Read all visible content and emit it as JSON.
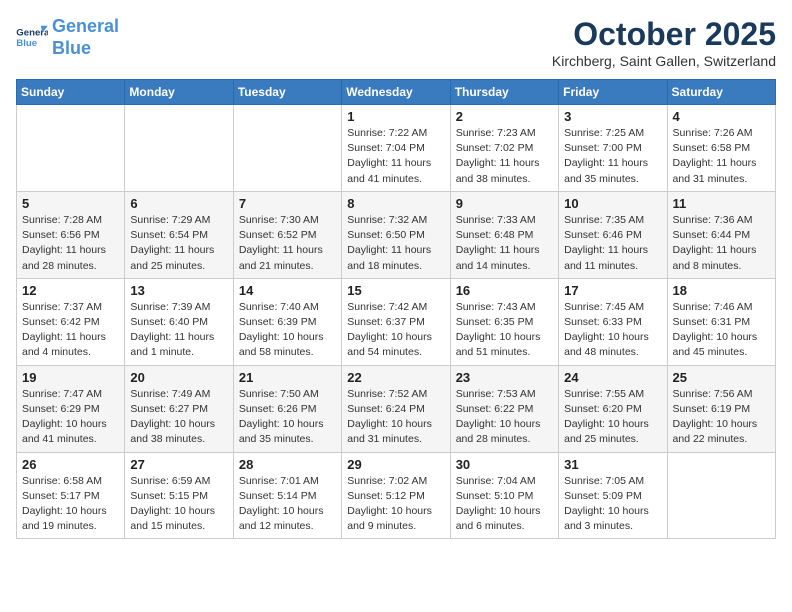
{
  "header": {
    "logo_line1": "General",
    "logo_line2": "Blue",
    "month": "October 2025",
    "location": "Kirchberg, Saint Gallen, Switzerland"
  },
  "days_of_week": [
    "Sunday",
    "Monday",
    "Tuesday",
    "Wednesday",
    "Thursday",
    "Friday",
    "Saturday"
  ],
  "weeks": [
    [
      {
        "day": "",
        "info": ""
      },
      {
        "day": "",
        "info": ""
      },
      {
        "day": "",
        "info": ""
      },
      {
        "day": "1",
        "info": "Sunrise: 7:22 AM\nSunset: 7:04 PM\nDaylight: 11 hours\nand 41 minutes."
      },
      {
        "day": "2",
        "info": "Sunrise: 7:23 AM\nSunset: 7:02 PM\nDaylight: 11 hours\nand 38 minutes."
      },
      {
        "day": "3",
        "info": "Sunrise: 7:25 AM\nSunset: 7:00 PM\nDaylight: 11 hours\nand 35 minutes."
      },
      {
        "day": "4",
        "info": "Sunrise: 7:26 AM\nSunset: 6:58 PM\nDaylight: 11 hours\nand 31 minutes."
      }
    ],
    [
      {
        "day": "5",
        "info": "Sunrise: 7:28 AM\nSunset: 6:56 PM\nDaylight: 11 hours\nand 28 minutes."
      },
      {
        "day": "6",
        "info": "Sunrise: 7:29 AM\nSunset: 6:54 PM\nDaylight: 11 hours\nand 25 minutes."
      },
      {
        "day": "7",
        "info": "Sunrise: 7:30 AM\nSunset: 6:52 PM\nDaylight: 11 hours\nand 21 minutes."
      },
      {
        "day": "8",
        "info": "Sunrise: 7:32 AM\nSunset: 6:50 PM\nDaylight: 11 hours\nand 18 minutes."
      },
      {
        "day": "9",
        "info": "Sunrise: 7:33 AM\nSunset: 6:48 PM\nDaylight: 11 hours\nand 14 minutes."
      },
      {
        "day": "10",
        "info": "Sunrise: 7:35 AM\nSunset: 6:46 PM\nDaylight: 11 hours\nand 11 minutes."
      },
      {
        "day": "11",
        "info": "Sunrise: 7:36 AM\nSunset: 6:44 PM\nDaylight: 11 hours\nand 8 minutes."
      }
    ],
    [
      {
        "day": "12",
        "info": "Sunrise: 7:37 AM\nSunset: 6:42 PM\nDaylight: 11 hours\nand 4 minutes."
      },
      {
        "day": "13",
        "info": "Sunrise: 7:39 AM\nSunset: 6:40 PM\nDaylight: 11 hours\nand 1 minute."
      },
      {
        "day": "14",
        "info": "Sunrise: 7:40 AM\nSunset: 6:39 PM\nDaylight: 10 hours\nand 58 minutes."
      },
      {
        "day": "15",
        "info": "Sunrise: 7:42 AM\nSunset: 6:37 PM\nDaylight: 10 hours\nand 54 minutes."
      },
      {
        "day": "16",
        "info": "Sunrise: 7:43 AM\nSunset: 6:35 PM\nDaylight: 10 hours\nand 51 minutes."
      },
      {
        "day": "17",
        "info": "Sunrise: 7:45 AM\nSunset: 6:33 PM\nDaylight: 10 hours\nand 48 minutes."
      },
      {
        "day": "18",
        "info": "Sunrise: 7:46 AM\nSunset: 6:31 PM\nDaylight: 10 hours\nand 45 minutes."
      }
    ],
    [
      {
        "day": "19",
        "info": "Sunrise: 7:47 AM\nSunset: 6:29 PM\nDaylight: 10 hours\nand 41 minutes."
      },
      {
        "day": "20",
        "info": "Sunrise: 7:49 AM\nSunset: 6:27 PM\nDaylight: 10 hours\nand 38 minutes."
      },
      {
        "day": "21",
        "info": "Sunrise: 7:50 AM\nSunset: 6:26 PM\nDaylight: 10 hours\nand 35 minutes."
      },
      {
        "day": "22",
        "info": "Sunrise: 7:52 AM\nSunset: 6:24 PM\nDaylight: 10 hours\nand 31 minutes."
      },
      {
        "day": "23",
        "info": "Sunrise: 7:53 AM\nSunset: 6:22 PM\nDaylight: 10 hours\nand 28 minutes."
      },
      {
        "day": "24",
        "info": "Sunrise: 7:55 AM\nSunset: 6:20 PM\nDaylight: 10 hours\nand 25 minutes."
      },
      {
        "day": "25",
        "info": "Sunrise: 7:56 AM\nSunset: 6:19 PM\nDaylight: 10 hours\nand 22 minutes."
      }
    ],
    [
      {
        "day": "26",
        "info": "Sunrise: 6:58 AM\nSunset: 5:17 PM\nDaylight: 10 hours\nand 19 minutes."
      },
      {
        "day": "27",
        "info": "Sunrise: 6:59 AM\nSunset: 5:15 PM\nDaylight: 10 hours\nand 15 minutes."
      },
      {
        "day": "28",
        "info": "Sunrise: 7:01 AM\nSunset: 5:14 PM\nDaylight: 10 hours\nand 12 minutes."
      },
      {
        "day": "29",
        "info": "Sunrise: 7:02 AM\nSunset: 5:12 PM\nDaylight: 10 hours\nand 9 minutes."
      },
      {
        "day": "30",
        "info": "Sunrise: 7:04 AM\nSunset: 5:10 PM\nDaylight: 10 hours\nand 6 minutes."
      },
      {
        "day": "31",
        "info": "Sunrise: 7:05 AM\nSunset: 5:09 PM\nDaylight: 10 hours\nand 3 minutes."
      },
      {
        "day": "",
        "info": ""
      }
    ]
  ]
}
